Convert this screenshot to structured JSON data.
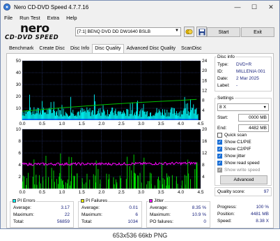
{
  "window": {
    "title": "Nero CD-DVD Speed 4.7.7.16",
    "minimize": "—",
    "maximize": "☐",
    "close": "✕"
  },
  "menu": [
    "File",
    "Run Test",
    "Extra",
    "Help"
  ],
  "logo": {
    "line1": "nero",
    "line2": "CD·DVD SPEED"
  },
  "toolbar": {
    "drive": "[7:1]  BENQ DVD DD DW1640 BSLB",
    "start_label": "Start",
    "exit_label": "Exit"
  },
  "tabs": [
    "Benchmark",
    "Create Disc",
    "Disc Info",
    "Disc Quality",
    "Advanced Disc Quality",
    "ScanDisc"
  ],
  "active_tab": 3,
  "disc_info": {
    "title": "Disc info",
    "type_label": "Type:",
    "type_value": "DVD+R",
    "id_label": "ID:",
    "id_value": "MILLENIA 001",
    "date_label": "Date:",
    "date_value": "2 Mar 2025",
    "label_label": "Label:",
    "label_value": "-"
  },
  "settings": {
    "title": "Settings",
    "speed": "8 X",
    "start_label": "Start:",
    "start_value": "0000 MB",
    "end_label": "End:",
    "end_value": "4482 MB",
    "checkboxes": [
      {
        "label": "Quick scan",
        "checked": false,
        "disabled": false
      },
      {
        "label": "Show C1/PIE",
        "checked": true,
        "disabled": false
      },
      {
        "label": "Show C2/PIF",
        "checked": true,
        "disabled": false
      },
      {
        "label": "Show jitter",
        "checked": true,
        "disabled": false
      },
      {
        "label": "Show read speed",
        "checked": true,
        "disabled": false
      },
      {
        "label": "Show write speed",
        "checked": true,
        "disabled": true
      }
    ],
    "advanced_label": "Advanced"
  },
  "quality": {
    "label": "Quality score:",
    "value": "97"
  },
  "progress": {
    "progress_label": "Progress:",
    "progress_value": "100 %",
    "position_label": "Position:",
    "position_value": "4481 MB",
    "speed_label": "Speed:",
    "speed_value": "8.38 X"
  },
  "pi_errors": {
    "title": "PI Errors",
    "color": "#00ffff",
    "average_label": "Average:",
    "average_value": "3.17",
    "maximum_label": "Maximum:",
    "maximum_value": "22",
    "total_label": "Total:",
    "total_value": "56859"
  },
  "pi_failures": {
    "title": "PI Failures",
    "color": "#ffff00",
    "average_label": "Average:",
    "average_value": "0.01",
    "maximum_label": "Maximum:",
    "maximum_value": "6",
    "total_label": "Total:",
    "total_value": "1034"
  },
  "jitter": {
    "title": "Jitter",
    "color": "#ff00ff",
    "average_label": "Average:",
    "average_value": "8.35 %",
    "maximum_label": "Maximum:",
    "maximum_value": "10.9 %",
    "po_label": "PO failures:",
    "po_value": "0"
  },
  "caption": "653x536  66kb  PNG",
  "chart_data": [
    {
      "type": "bar",
      "name": "PI Errors",
      "x_ticks": [
        "0.0",
        "0.5",
        "1.0",
        "1.5",
        "2.0",
        "2.5",
        "3.0",
        "3.5",
        "4.0",
        "4.5"
      ],
      "y_left_ticks": [
        "50",
        "40",
        "30",
        "20",
        "10"
      ],
      "y_right_ticks": [
        "24",
        "20",
        "16",
        "12",
        "8",
        "4"
      ],
      "xlim": [
        0,
        4.5
      ],
      "ylim_left": [
        0,
        50
      ],
      "ylim_right": [
        0,
        24
      ],
      "series": [
        {
          "values_approx": "PI errors mostly 2-12, peaks near 22",
          "color": "#00ffff"
        },
        {
          "name": "read speed",
          "values": [
            [
              0.0,
              3.6
            ],
            [
              1.0,
              5.0
            ],
            [
              2.0,
              6.2
            ],
            [
              3.0,
              7.2
            ],
            [
              4.0,
              8.0
            ],
            [
              4.4,
              8.4
            ]
          ],
          "color": "#00c000"
        }
      ]
    },
    {
      "type": "bar",
      "name": "PI Failures / Jitter",
      "x_ticks": [
        "0.0",
        "0.5",
        "1.0",
        "1.5",
        "2.0",
        "2.5",
        "3.0",
        "3.5",
        "4.0",
        "4.5"
      ],
      "y_left_ticks": [
        "10",
        "8",
        "6",
        "4",
        "2"
      ],
      "y_right_ticks": [
        "20",
        "16",
        "12",
        "8",
        "4"
      ],
      "xlim": [
        0,
        4.5
      ],
      "ylim_left": [
        0,
        10
      ],
      "ylim_right": [
        0,
        20
      ],
      "series": [
        {
          "values_approx": "PI failures sparse spikes 1-6",
          "color": "#00ff00"
        },
        {
          "name": "jitter",
          "values": [
            [
              0.0,
              8.2
            ],
            [
              1.0,
              8.3
            ],
            [
              2.0,
              8.3
            ],
            [
              3.0,
              8.4
            ],
            [
              4.0,
              8.5
            ],
            [
              4.4,
              8.6
            ]
          ],
          "color": "#ff00ff"
        }
      ]
    }
  ]
}
